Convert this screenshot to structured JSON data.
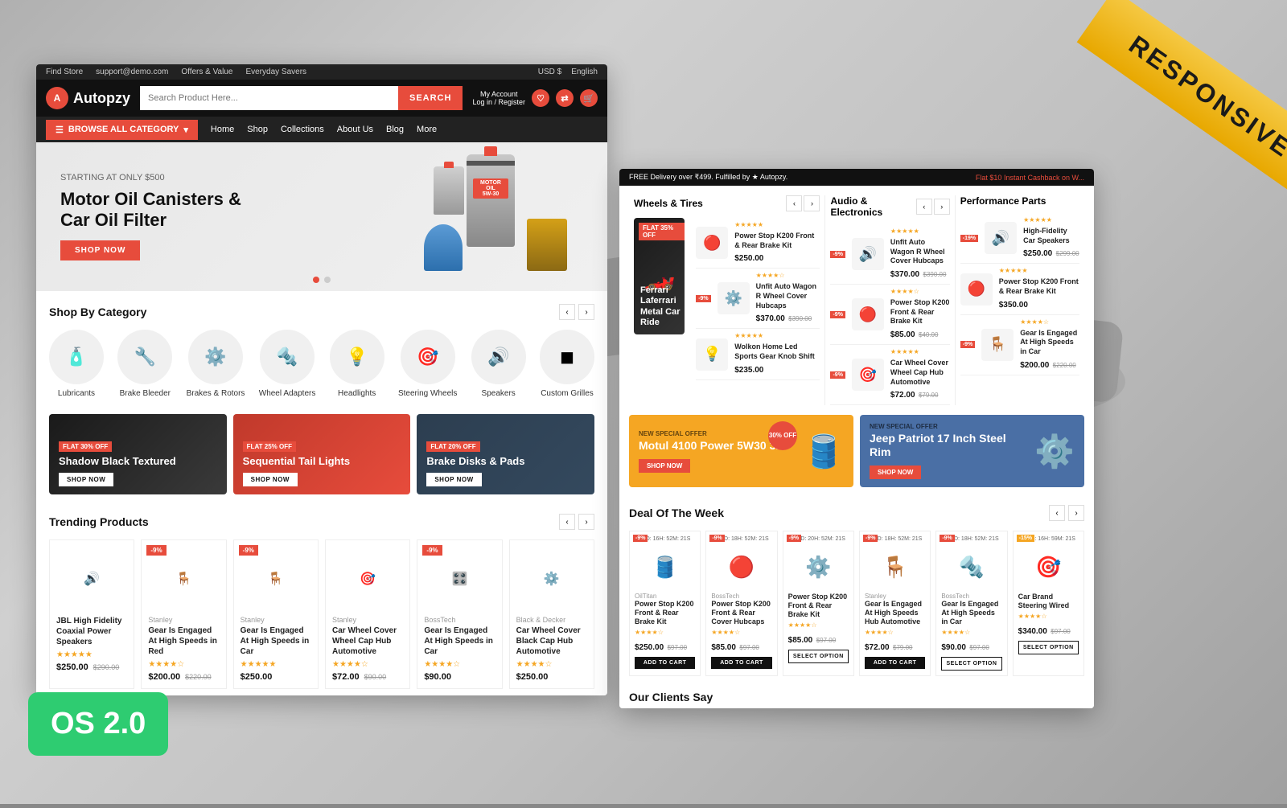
{
  "page": {
    "background_note": "racing cars background"
  },
  "ribbon": {
    "text": "RESPONSIVE"
  },
  "os_badge": {
    "text": "OS 2.0"
  },
  "left_store": {
    "top_bar": {
      "find_store": "Find Store",
      "support": "support@demo.com",
      "offers": "Offers & Value",
      "everyday": "Everyday Savers",
      "currency": "USD $",
      "language": "English"
    },
    "header": {
      "logo_text": "Autopzy",
      "search_placeholder": "Search Product Here...",
      "search_btn": "SEARCH",
      "account_label": "My Account",
      "login_label": "Log in / Register"
    },
    "nav": {
      "browse_btn": "BROWSE ALL CATEGORY",
      "links": [
        "Home",
        "Shop",
        "Collections",
        "About Us",
        "Blog",
        "More"
      ]
    },
    "hero": {
      "starting_text": "STARTING AT ONLY $500",
      "title_line1": "Motor Oil Canisters &",
      "title_line2": "Car Oil Filter",
      "btn": "SHOP NOW"
    },
    "categories": {
      "title": "Shop By Category",
      "items": [
        {
          "label": "Lubricants",
          "icon": "🧴"
        },
        {
          "label": "Brake Bleeder",
          "icon": "🔧"
        },
        {
          "label": "Brakes & Rotors",
          "icon": "⚙️"
        },
        {
          "label": "Wheel Adapters",
          "icon": "🔩"
        },
        {
          "label": "Headlights",
          "icon": "💡"
        },
        {
          "label": "Steering Wheels",
          "icon": "🎯"
        },
        {
          "label": "Speakers",
          "icon": "🔊"
        },
        {
          "label": "Custom Grilles",
          "icon": "◼"
        }
      ]
    },
    "promos": [
      {
        "badge": "FLAT 30% OFF",
        "title": "Shadow Black Textured",
        "btn": "SHOP NOW",
        "theme": "dark"
      },
      {
        "badge": "FLAT 25% OFF",
        "title": "Sequential Tail Lights",
        "btn": "SHOP NOW",
        "theme": "red"
      },
      {
        "badge": "FLAT 20% OFF",
        "title": "Brake Disks & Pads",
        "btn": "SHOP NOW",
        "theme": "gray"
      }
    ],
    "trending": {
      "title": "Trending Products",
      "products": [
        {
          "badge": "",
          "brand": "",
          "name": "JBL High Fidelity Coaxial Power Speakers",
          "price": "$250.00",
          "old_price": "$290.00",
          "icon": "🔊"
        },
        {
          "badge": "-9%",
          "brand": "Stanley",
          "name": "Gear Is Engaged At High Speeds in Red",
          "price": "$200.00",
          "old_price": "$220.00",
          "icon": "🪑"
        },
        {
          "badge": "-9%",
          "brand": "Stanley",
          "name": "Gear Is Engaged At High Speeds in Car",
          "price": "$250.00",
          "old_price": "",
          "icon": "🪑"
        },
        {
          "badge": "",
          "brand": "Stanley",
          "name": "Car Wheel Cover Wheel Cap Hub Automotive",
          "price": "$72.00",
          "old_price": "$90.00",
          "icon": "🎯"
        },
        {
          "badge": "-9%",
          "brand": "BossTech",
          "name": "Gear Is Engaged At High Speeds in Car",
          "price": "$90.00",
          "old_price": "",
          "icon": "🎛️"
        },
        {
          "badge": "",
          "brand": "Black & Decker",
          "name": "Car Wheel Cover Black Cap Hub Automotive",
          "price": "$250.00",
          "old_price": "",
          "icon": "⚙️"
        }
      ]
    }
  },
  "right_store": {
    "delivery_bar": {
      "text": "FREE Delivery over ₹499. Fulfilled by ★ Autopzy.",
      "highlight": "Flat $10 Instant Cashback on W..."
    },
    "sections": {
      "wheels_tires": {
        "title": "Wheels & Tires",
        "featured": {
          "badge": "FLAT 35% OFF",
          "title": "Ferrari Laferrari Metal Car Ride"
        },
        "products": [
          {
            "name": "Power Stop K200 Front & Rear Brake Kit",
            "price": "$250.00",
            "old": "",
            "badge": "",
            "icon": "🔴"
          },
          {
            "name": "Unfit Auto Wagon R Wheel Cover Hubcaps",
            "price": "$370.00",
            "old": "$390.00",
            "badge": "-9%",
            "icon": "⚙️"
          },
          {
            "name": "Wolkon Home Led Sports Gear Knob Shift",
            "price": "$235.00",
            "old": "",
            "badge": "",
            "icon": "💡"
          }
        ]
      },
      "audio_electronics": {
        "title": "Audio & Electronics",
        "products": [
          {
            "name": "Unfit Auto Wagon R Wheel Cover Hubcaps",
            "price": "$370.00",
            "old": "$390.00",
            "badge": "-9%",
            "icon": "🔊"
          },
          {
            "name": "Power Stop K200 Front & Rear Brake Kit",
            "price": "$85.00",
            "old": "$40.00",
            "badge": "-9%",
            "icon": "🔴"
          },
          {
            "name": "Car Wheel Cover Wheel Cap Hub Automotive",
            "price": "$72.00",
            "old": "$79.00",
            "badge": "-9%",
            "icon": "🎯"
          }
        ]
      },
      "performance_parts": {
        "title": "Performance Parts",
        "products": [
          {
            "name": "High-Fidelity Car Speakers",
            "price": "$250.00",
            "old": "$299.00",
            "badge": "-19%",
            "icon": "🔊"
          },
          {
            "name": "Power Stop K200 Front & Rear Brake Kit",
            "price": "$350.00",
            "old": "",
            "badge": "",
            "icon": "🔴"
          },
          {
            "name": "Gear Is Engaged At High Speeds in Car",
            "price": "$200.00",
            "old": "$220.00",
            "badge": "-9%",
            "icon": "🪑"
          }
        ]
      }
    },
    "special_offers": [
      {
        "label": "NEW SPECIAL OFFER",
        "title": "Motul 4100 Power 5W30 3L",
        "btn": "SHOP NOW",
        "discount": "30% OFF",
        "theme": "yellow",
        "icon": "🛢️"
      },
      {
        "label": "NEW SPECIAL OFFER",
        "title": "Jeep Patriot 17 Inch Steel Rim",
        "btn": "SHOP NOW",
        "discount": "",
        "theme": "blue",
        "icon": "⚙️"
      }
    ],
    "deal_of_week": {
      "title": "Deal Of The Week",
      "products": [
        {
          "badge": "-9%",
          "timer": "88D: 16H: 52M: 21S",
          "brand": "OilTitan",
          "name": "Power Stop K200 Front & Rear Brake Kit",
          "price": "$250.00",
          "old": "$97.00",
          "btn": "ADD TO CART",
          "btn_style": "solid",
          "icon": "🛢️"
        },
        {
          "badge": "-9%",
          "timer": "925D: 18H: 52M: 21S",
          "brand": "BossTech",
          "name": "Power Stop K200 Front & Rear Cover Hubcaps",
          "price": "$85.00",
          "old": "$97.00",
          "btn": "ADD TO CART",
          "btn_style": "solid",
          "icon": "🔴"
        },
        {
          "badge": "-9%",
          "timer": "779D: 20H: 52M: 21S",
          "brand": "",
          "name": "Power Stop K200 Front & Rear Brake Kit",
          "price": "$85.00",
          "old": "$97.00",
          "btn": "SELECT OPTION",
          "btn_style": "outline",
          "icon": "⚙️"
        },
        {
          "badge": "-9%",
          "timer": "816D: 18H: 52M: 21S",
          "brand": "Stanley",
          "name": "Gear Is Engaged At High Speeds Hub Automotive",
          "price": "$72.00",
          "old": "$79.00",
          "btn": "ADD TO CART",
          "btn_style": "solid",
          "icon": "🪑"
        },
        {
          "badge": "-9%",
          "timer": "851D: 18H: 52M: 21S",
          "brand": "BossTech",
          "name": "Gear Is Engaged At High Speeds in Car",
          "price": "$90.00",
          "old": "$97.00",
          "btn": "SELECT OPTION",
          "btn_style": "outline",
          "icon": "🔩"
        },
        {
          "badge": "-15%",
          "timer": "755D: 16H: 59M: 21S",
          "brand": "",
          "name": "Car Brand Steering Wired",
          "price": "$340.00",
          "old": "$97.00",
          "btn": "SELECT OPTION",
          "btn_style": "outline",
          "icon": "🎯"
        }
      ]
    },
    "clients": {
      "title": "Our Clients Say"
    }
  }
}
